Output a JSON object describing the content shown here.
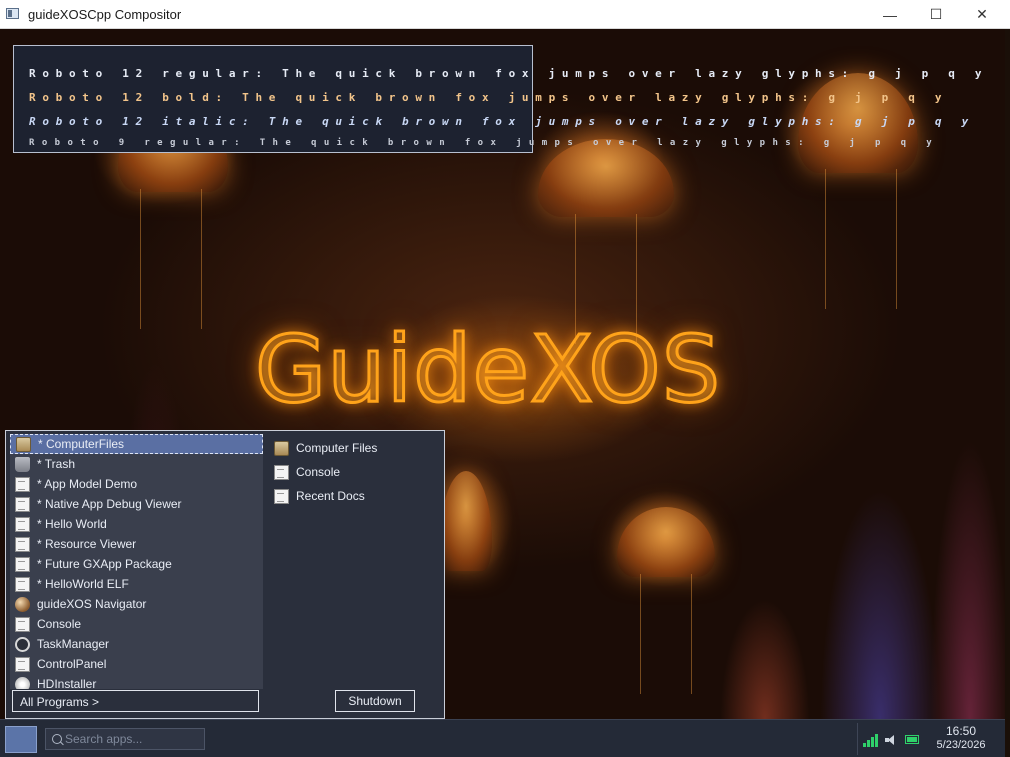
{
  "window": {
    "title": "guideXOSCpp Compositor",
    "minimize_glyph": "—",
    "maximize_glyph": "☐",
    "close_glyph": "✕"
  },
  "desktop": {
    "logo_text": "GuideXOS",
    "font_test": [
      "Roboto 12 regular: The quick brown fox jumps over lazy glyphs: g j p q y",
      "Roboto 12 bold: The quick brown fox jumps over lazy glyphs: g j p q y",
      "Roboto 12 italic: The quick brown fox jumps over lazy glyphs: g j p q y",
      "Roboto 9 regular: The quick brown fox jumps over lazy glyphs: g j p q y"
    ]
  },
  "start_menu": {
    "left_items": [
      {
        "label": "* ComputerFiles",
        "icon": "folder-icon",
        "selected": true
      },
      {
        "label": "* Trash",
        "icon": "trash-icon"
      },
      {
        "label": "* App Model Demo",
        "icon": "document-icon"
      },
      {
        "label": "* Native App Debug Viewer",
        "icon": "document-icon"
      },
      {
        "label": "* Hello World",
        "icon": "document-icon"
      },
      {
        "label": "* Resource Viewer",
        "icon": "document-icon"
      },
      {
        "label": "* Future GXApp Package",
        "icon": "document-icon"
      },
      {
        "label": "* HelloWorld ELF",
        "icon": "document-icon"
      },
      {
        "label": "guideXOS Navigator",
        "icon": "globe-icon"
      },
      {
        "label": "Console",
        "icon": "document-icon"
      },
      {
        "label": "TaskManager",
        "icon": "gauge-icon"
      },
      {
        "label": "ControlPanel",
        "icon": "document-icon"
      },
      {
        "label": "HDInstaller",
        "icon": "disc-icon"
      }
    ],
    "right_items": [
      {
        "label": "Computer Files",
        "icon": "folder-icon"
      },
      {
        "label": "Console",
        "icon": "document-icon"
      },
      {
        "label": "Recent Docs",
        "icon": "document-icon"
      }
    ],
    "all_programs_label": "All Programs >",
    "shutdown_label": "Shutdown"
  },
  "taskbar": {
    "search_placeholder": "Search apps...",
    "clock_time": "16:50",
    "clock_date": "5/23/2026",
    "tray_icons": [
      "signal-icon",
      "volume-icon",
      "battery-icon"
    ],
    "colors": {
      "accent": "#5b74a8",
      "signal": "#2fd16a",
      "battery": "#2fd16a"
    }
  }
}
